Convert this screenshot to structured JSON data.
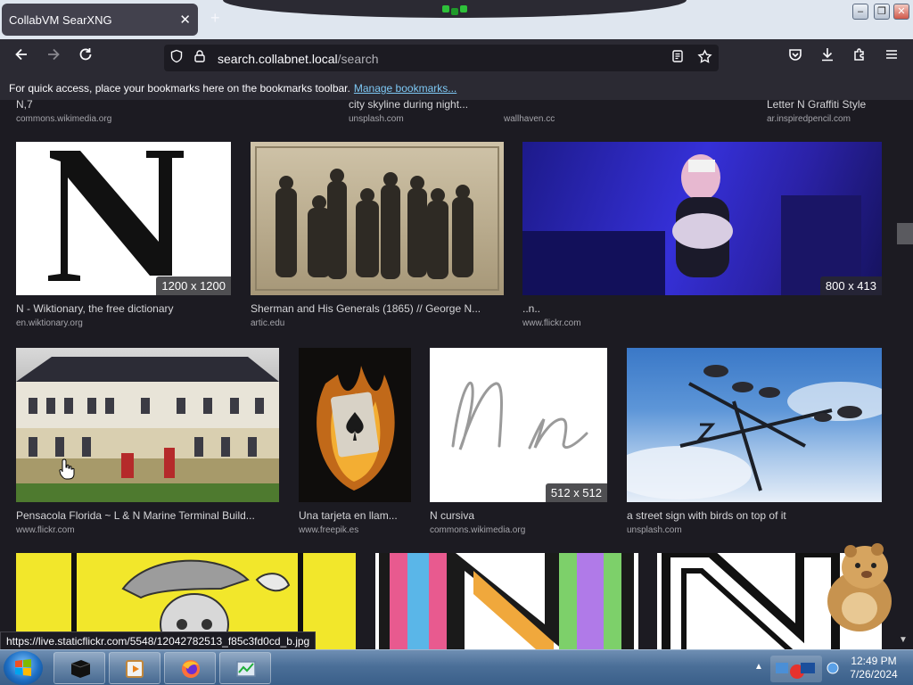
{
  "browser": {
    "tab_title": "CollabVM SearXNG",
    "url_host": "search.collabnet.local",
    "url_path": "/search",
    "bookmarks_hint": "For quick access, place your bookmarks here on the bookmarks toolbar.",
    "bookmarks_link": "Manage bookmarks..."
  },
  "results_top_partial": [
    {
      "title": "N,7",
      "source": "commons.wikimedia.org"
    },
    {
      "title": "city skyline during night...",
      "source": "unsplash.com"
    },
    {
      "title": "",
      "source": "wallhaven.cc"
    },
    {
      "title": "Letter N Graffiti Style",
      "source": "ar.inspiredpencil.com"
    }
  ],
  "results_row1": [
    {
      "title": "N - Wiktionary, the free dictionary",
      "source": "en.wiktionary.org",
      "dimensions": "1200 x 1200",
      "thumb_icon": "letter-n-icon"
    },
    {
      "title": "Sherman and His Generals (1865) // George N...",
      "source": "artic.edu",
      "dimensions": "",
      "thumb_icon": "sepia-photo"
    },
    {
      "title": "..n..",
      "source": "www.flickr.com",
      "dimensions": "800 x 413",
      "thumb_icon": "neon-photo"
    }
  ],
  "results_row2": [
    {
      "title": "Pensacola Florida ~ L & N Marine Terminal Build...",
      "source": "www.flickr.com",
      "dimensions": "",
      "thumb_icon": "building-photo"
    },
    {
      "title": "Una tarjeta en llam...",
      "source": "www.freepik.es",
      "dimensions": "",
      "thumb_icon": "burning-ace-card"
    },
    {
      "title": "N cursiva",
      "source": "commons.wikimedia.org",
      "dimensions": "512 x 512",
      "thumb_icon": "cursive-n"
    },
    {
      "title": "a street sign with birds on top of it",
      "source": "unsplash.com",
      "dimensions": "",
      "thumb_icon": "birds-sign-photo"
    }
  ],
  "status_bar_url": "https://live.staticflickr.com/5548/12042782513_f85c3fd0cd_b.jpg",
  "taskbar": {
    "time": "12:49 PM",
    "date": "7/26/2024"
  },
  "colors": {
    "page_bg": "#1c1b22",
    "toolbar_bg": "#2b2a33",
    "link": "#7ec9f5"
  }
}
